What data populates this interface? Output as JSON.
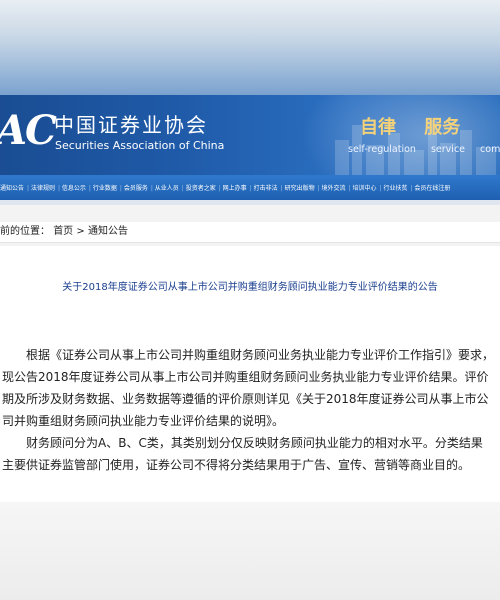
{
  "header": {
    "logo_text": "AC",
    "association_cn": "中国证券业协会",
    "association_en": "Securities Association of China",
    "slogan_cn": [
      "自律",
      "服务"
    ],
    "slogan_en": [
      "self-regulation",
      "service",
      "comm"
    ]
  },
  "nav": {
    "items": [
      "通知公告",
      "法律规则",
      "信息公示",
      "行业数据",
      "会员服务",
      "从业人员",
      "投资者之家",
      "网上办事",
      "打击非法",
      "研究出版物",
      "境外交流",
      "培训中心",
      "行业扶贫",
      "会员在线注册"
    ]
  },
  "breadcrumb": {
    "prefix": "前的位置：",
    "home": "首页",
    "separator": ">",
    "current": "通知公告"
  },
  "notice": {
    "title": "关于2018年度证券公司从事上市公司并购重组财务顾问执业能力专业评价结果的公告",
    "para1": "根据《证券公司从事上市公司并购重组财务顾问业务执业能力专业评价工作指引》要求，现公告2018年度证券公司从事上市公司并购重组财务顾问业务执业能力专业评价结果。评价期及所涉及财务数据、业务数据等遵循的评价原则详见《关于2018年度证券公司从事上市公司并购重组财务顾问执业能力专业评价结果的说明》。",
    "para2": "财务顾问分为A、B、C类，其类别划分仅反映财务顾问执业能力的相对水平。分类结果主要供证券监管部门使用，证券公司不得将分类结果用于广告、宣传、营销等商业目的。"
  },
  "colors": {
    "banner": "#1f5aa8",
    "nav": "#2a6fc4",
    "slogan_gold": "#f3d27a",
    "title_blue": "#1a3f8f"
  }
}
